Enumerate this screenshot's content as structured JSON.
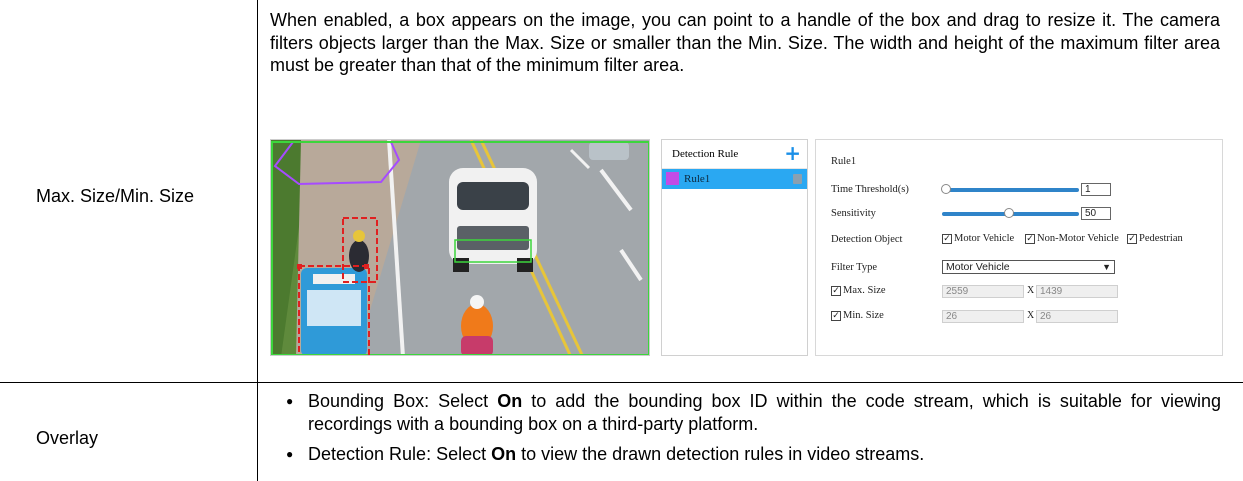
{
  "table": {
    "rows": [
      {
        "parameter": "Max. Size/Min. Size",
        "description": "When enabled, a box appears on the image, you can point to a handle of the box and drag to resize it. The camera filters objects larger than the Max. Size or smaller than the Min. Size. The width and height of the maximum filter area must be greater than that of the minimum filter area."
      },
      {
        "parameter": "Overlay",
        "bullets": [
          {
            "pre": "Bounding Box: Select ",
            "bold": "On",
            "post": " to add the bounding box ID within the code stream, which is suitable for viewing recordings with a bounding box on a third-party platform."
          },
          {
            "pre": "Detection Rule: Select ",
            "bold": "On",
            "post": " to view the drawn detection rules in video streams."
          }
        ]
      }
    ]
  },
  "screenshot": {
    "detection_rule_panel": {
      "header": "Detection Rule",
      "add_icon": "plus-icon",
      "rules": [
        {
          "name": "Rule1",
          "color": "#c24be6",
          "selected": true
        }
      ]
    },
    "settings": {
      "title": "Rule1",
      "time_threshold": {
        "label": "Time Threshold(s)",
        "value": "1",
        "level": 0.0
      },
      "sensitivity": {
        "label": "Sensitivity",
        "value": "50",
        "level": 0.5
      },
      "detection_object": {
        "label": "Detection Object",
        "options": [
          {
            "label": "Motor Vehicle",
            "checked": true
          },
          {
            "label": "Non-Motor Vehicle",
            "checked": true
          },
          {
            "label": "Pedestrian",
            "checked": true
          }
        ]
      },
      "filter_type": {
        "label": "Filter Type",
        "selected": "Motor Vehicle"
      },
      "max_size": {
        "label": "Max. Size",
        "checked": true,
        "width": "2559",
        "height": "1439"
      },
      "min_size": {
        "label": "Min. Size",
        "checked": true,
        "width": "26",
        "height": "26"
      },
      "separator": "X"
    },
    "colors": {
      "accent": "#2aa8f2",
      "slider": "#2f84c9",
      "rule_polygon": "#a64bff",
      "filter_box": "#3cd63c",
      "target_box": "#e02020"
    }
  }
}
